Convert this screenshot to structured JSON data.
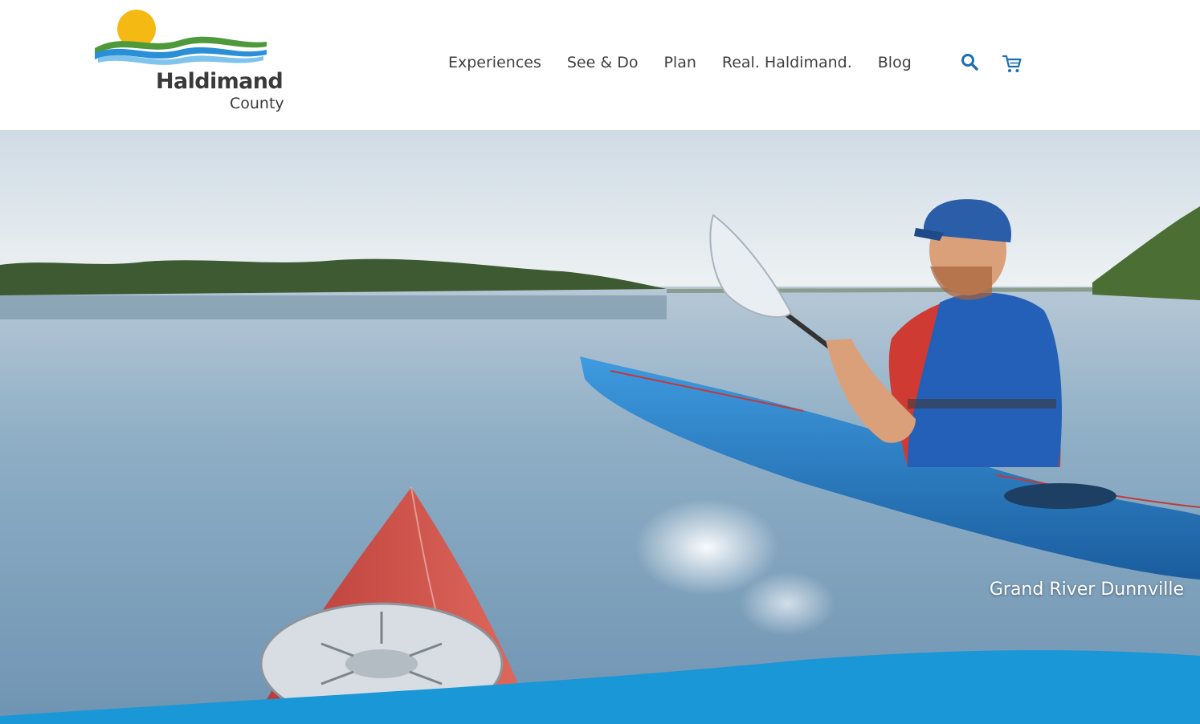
{
  "header": {
    "logo": {
      "line1": "Haldimand",
      "line2": "County",
      "icon": "sun-river-logo-icon"
    },
    "nav": [
      {
        "label": "Experiences"
      },
      {
        "label": "See & Do"
      },
      {
        "label": "Plan"
      },
      {
        "label": "Real. Haldimand."
      },
      {
        "label": "Blog"
      }
    ],
    "icons": {
      "search": "search-icon",
      "cart": "cart-icon"
    }
  },
  "hero": {
    "caption": "Grand River Dunnville",
    "image": "kayakers-on-river-photo"
  },
  "colors": {
    "brand_blue": "#1a97d6",
    "nav_icon_blue": "#1e6fb4",
    "sun_yellow": "#f5b914",
    "logo_green": "#4e9a3a",
    "text_dark": "#3f3f3f"
  }
}
